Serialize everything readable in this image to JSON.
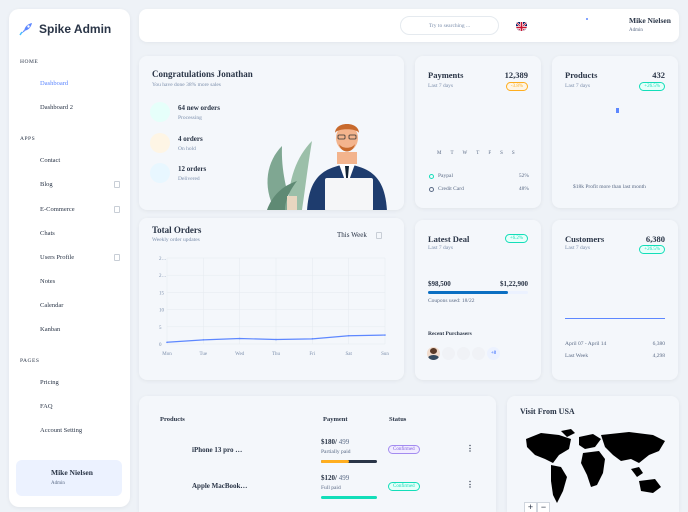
{
  "brand": {
    "name": "Spike Admin"
  },
  "sidebar": {
    "sections": [
      {
        "title": "HOME",
        "items": [
          {
            "label": "Dashboard",
            "active": true
          },
          {
            "label": "Dashboard 2"
          }
        ]
      },
      {
        "title": "APPS",
        "items": [
          {
            "label": "Contact"
          },
          {
            "label": "Blog",
            "submenu": true
          },
          {
            "label": "E-Commerce",
            "submenu": true
          },
          {
            "label": "Chats"
          },
          {
            "label": "Users Profile",
            "submenu": true
          },
          {
            "label": "Notes"
          },
          {
            "label": "Calendar"
          },
          {
            "label": "Kanban"
          }
        ]
      },
      {
        "title": "PAGES",
        "items": [
          {
            "label": "Pricing"
          },
          {
            "label": "FAQ"
          },
          {
            "label": "Account Setting"
          }
        ]
      }
    ],
    "profile": {
      "name": "Mike Nielsen",
      "role": "Admin"
    }
  },
  "header": {
    "search_placeholder": "Try to searching ...",
    "user_name": "Mike Nielsen",
    "user_role": "Admin"
  },
  "welcome": {
    "title": "Congratulations Jonathan",
    "subtitle": "You have done 38% more sales",
    "stats": [
      {
        "title": "64 new orders",
        "sub": "Processing",
        "color": "#e6fffa"
      },
      {
        "title": "4 orders",
        "sub": "On hold",
        "color": "#fef5e5"
      },
      {
        "title": "12 orders",
        "sub": "Delivered",
        "color": "#e8f7ff"
      }
    ]
  },
  "payments": {
    "title": "Payments",
    "value": "12,389",
    "sub": "Last 7 days",
    "badge": "-3.8%",
    "days": [
      "M",
      "T",
      "W",
      "T",
      "F",
      "S",
      "S"
    ],
    "legend": [
      {
        "label": "Paypal",
        "pct": "52%"
      },
      {
        "label": "Credit Card",
        "pct": "48%"
      }
    ]
  },
  "products": {
    "title": "Products",
    "value": "432",
    "sub": "Last 7 days",
    "badge": "+26.5%",
    "note": "$18k Profit more than last month"
  },
  "total_orders": {
    "title": "Total Orders",
    "sub": "Weekly order updates",
    "filter": "This Week"
  },
  "chart_data": {
    "type": "line",
    "categories": [
      "Mon",
      "Tue",
      "Wed",
      "Thu",
      "Fri",
      "Sat",
      "Sun"
    ],
    "y_ticks": [
      "0",
      "5",
      "10",
      "15",
      "20",
      "25"
    ],
    "tick_labels_y_visible": [
      "0",
      "5",
      "10",
      "15",
      "2…",
      "2…"
    ],
    "values": [
      0.5,
      1.2,
      1.6,
      1.3,
      1.5,
      2.4,
      2.6
    ],
    "ylim": [
      0,
      25
    ],
    "grid": true,
    "color": "#5d87ff"
  },
  "latest_deal": {
    "title": "Latest Deal",
    "sub": "Last 7 days",
    "badge": "+6.2%",
    "amount": "$98,500",
    "target": "$1,22,900",
    "coupons": "Coupons used: 18/22",
    "progress": 0.8,
    "recent_title": "Recent Purchasers",
    "more": "+8"
  },
  "customers": {
    "title": "Customers",
    "value": "6,380",
    "sub": "Last 7 days",
    "badge": "+26.5%",
    "rows": [
      {
        "label": "April 07 - April 14",
        "value": "6,380"
      },
      {
        "label": "Last Week",
        "value": "4,298"
      }
    ]
  },
  "product_table": {
    "headers": [
      "Products",
      "Payment",
      "Status"
    ],
    "rows": [
      {
        "name": "iPhone 13 pro …",
        "price": "$180/",
        "total": " 499",
        "payment": "Partially paid",
        "status": "Confirmed",
        "progress": 0.5,
        "bar_color": "#ffae1f"
      },
      {
        "name": "Apple MacBook…",
        "price": "$120/",
        "total": " 499",
        "payment": "Full paid",
        "status": "Confirmed",
        "progress": 1.0,
        "bar_color": "#13deb9"
      }
    ]
  },
  "map": {
    "title": "Visit From USA",
    "zoom_in": "+",
    "zoom_out": "−"
  }
}
